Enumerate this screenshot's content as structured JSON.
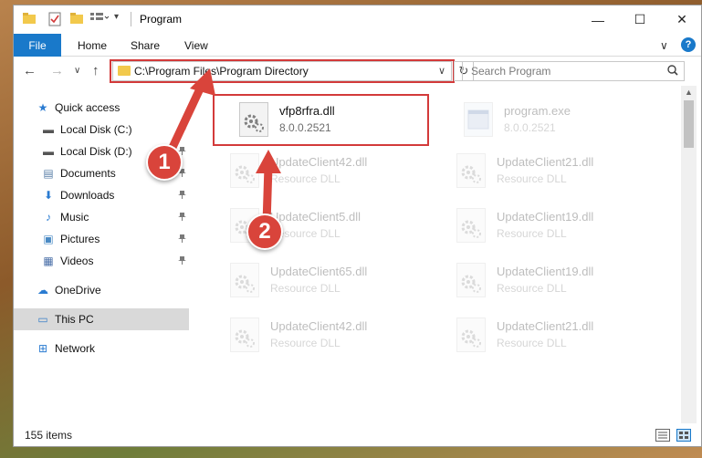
{
  "window": {
    "title": "Program",
    "controls": {
      "minimize": "—",
      "maximize": "☐",
      "close": "✕"
    }
  },
  "ribbon": {
    "file": "File",
    "tabs": [
      "Home",
      "Share",
      "View"
    ],
    "expand": "∨",
    "help": "?"
  },
  "navigation": {
    "back": "←",
    "forward": "→",
    "recent": "∨",
    "up": "↑",
    "address": "C:\\Program Files\\Program Directory",
    "address_dropdown": "∨",
    "refresh": "↻",
    "search_placeholder": "Search Program"
  },
  "sidebar": {
    "items": [
      {
        "label": "Quick access",
        "icon": "star-icon",
        "glyph": "★",
        "color": "#2a7bd1",
        "pinned": false
      },
      {
        "label": "Local Disk (C:)",
        "icon": "drive-icon",
        "glyph": "▬",
        "color": "#555555",
        "pinned": true
      },
      {
        "label": "Local Disk (D:)",
        "icon": "drive-icon",
        "glyph": "▬",
        "color": "#555555",
        "pinned": true
      },
      {
        "label": "Documents",
        "icon": "documents-icon",
        "glyph": "▤",
        "color": "#5a7fa8",
        "pinned": true
      },
      {
        "label": "Downloads",
        "icon": "download-icon",
        "glyph": "⬇",
        "color": "#2a7bd1",
        "pinned": true
      },
      {
        "label": "Music",
        "icon": "music-icon",
        "glyph": "♪",
        "color": "#2a7bd1",
        "pinned": true
      },
      {
        "label": "Pictures",
        "icon": "pictures-icon",
        "glyph": "▣",
        "color": "#4a8ac4",
        "pinned": true
      },
      {
        "label": "Videos",
        "icon": "videos-icon",
        "glyph": "▦",
        "color": "#4a6fa8",
        "pinned": true
      },
      {
        "label": "OneDrive",
        "icon": "cloud-icon",
        "glyph": "☁",
        "color": "#2a7bd1",
        "pinned": false
      },
      {
        "label": "This PC",
        "icon": "computer-icon",
        "glyph": "▭",
        "color": "#3a7fc8",
        "pinned": false
      },
      {
        "label": "Network",
        "icon": "network-icon",
        "glyph": "⊞",
        "color": "#2a7bd1",
        "pinned": false
      }
    ],
    "pin_glyph": "📌"
  },
  "files": [
    {
      "name": "vfp8rfra.dll",
      "type": "8.0.0.2521",
      "icon": "dll-gear-icon",
      "highlighted": true
    },
    {
      "name": "program.exe",
      "type": "8.0.0.2521",
      "icon": "exe-icon",
      "highlighted": false
    },
    {
      "name": "UpdateClient42.dll",
      "type": "Resource DLL",
      "icon": "dll-gear-icon",
      "highlighted": false
    },
    {
      "name": "UpdateClient21.dll",
      "type": "Resource DLL",
      "icon": "dll-gear-icon",
      "highlighted": false
    },
    {
      "name": "UpdateClient5.dll",
      "type": "Resource DLL",
      "icon": "dll-gear-icon",
      "highlighted": false
    },
    {
      "name": "UpdateClient19.dll",
      "type": "Resource DLL",
      "icon": "dll-gear-icon",
      "highlighted": false
    },
    {
      "name": "UpdateClient65.dll",
      "type": "Resource DLL",
      "icon": "dll-gear-icon",
      "highlighted": false
    },
    {
      "name": "UpdateClient19.dll",
      "type": "Resource DLL",
      "icon": "dll-gear-icon",
      "highlighted": false
    },
    {
      "name": "UpdateClient42.dll",
      "type": "Resource DLL",
      "icon": "dll-gear-icon",
      "highlighted": false
    },
    {
      "name": "UpdateClient21.dll",
      "type": "Resource DLL",
      "icon": "dll-gear-icon",
      "highlighted": false
    }
  ],
  "status": {
    "count": "155 items"
  },
  "annotations": {
    "step1": "1",
    "step2": "2",
    "color": "#d9443b"
  }
}
